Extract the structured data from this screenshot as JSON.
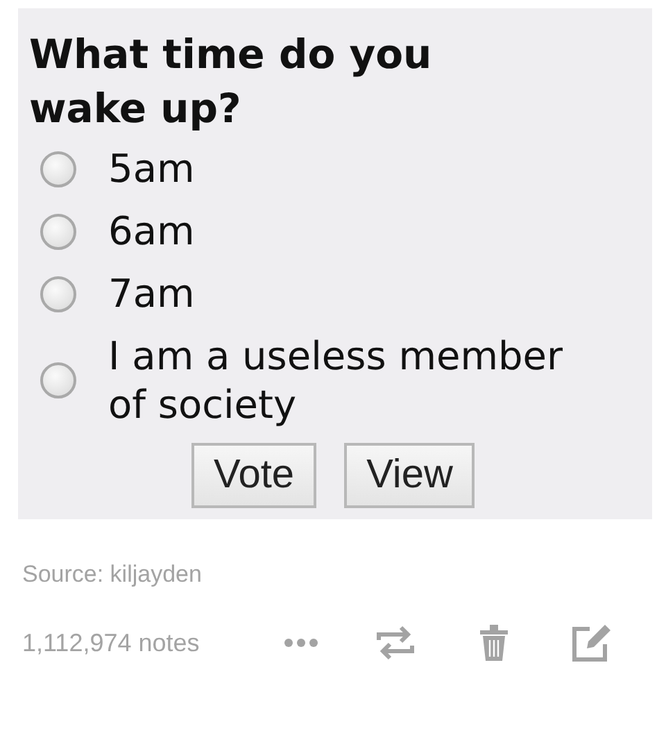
{
  "poll": {
    "question": "What time do you wake up?",
    "options": [
      {
        "label": "5am",
        "selected": false
      },
      {
        "label": "6am",
        "selected": false
      },
      {
        "label": "7am",
        "selected": false
      },
      {
        "label": "I am a useless member of society",
        "selected": false
      }
    ],
    "buttons": [
      "Vote",
      "View"
    ]
  },
  "source": "Source: kiljayden",
  "notes": "1,112,974 notes"
}
